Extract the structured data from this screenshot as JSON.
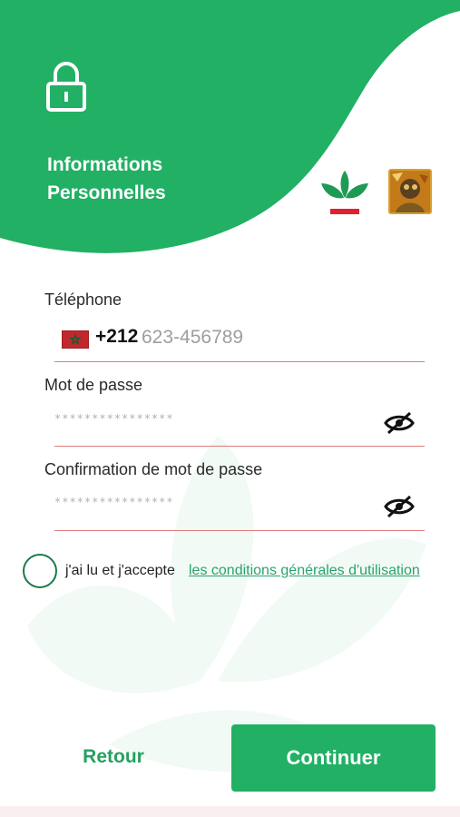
{
  "header": {
    "title_line1": "Informations",
    "title_line2": "Personnelles"
  },
  "colors": {
    "brand_green": "#22b064",
    "underline": "#e07a7a",
    "link": "#2aa36b"
  },
  "phone": {
    "label": "Téléphone",
    "country_flag": "morocco-flag",
    "prefix": "+212",
    "placeholder": "623-456789"
  },
  "password": {
    "label": "Mot de passe",
    "placeholder": "****************"
  },
  "confirm_password": {
    "label": "Confirmation de mot de passe",
    "placeholder": "****************"
  },
  "terms": {
    "text": "j'ai lu et j'accepte",
    "link": "les conditions générales d'utilisation"
  },
  "footer": {
    "back_label": "Retour",
    "continue_label": "Continuer"
  }
}
